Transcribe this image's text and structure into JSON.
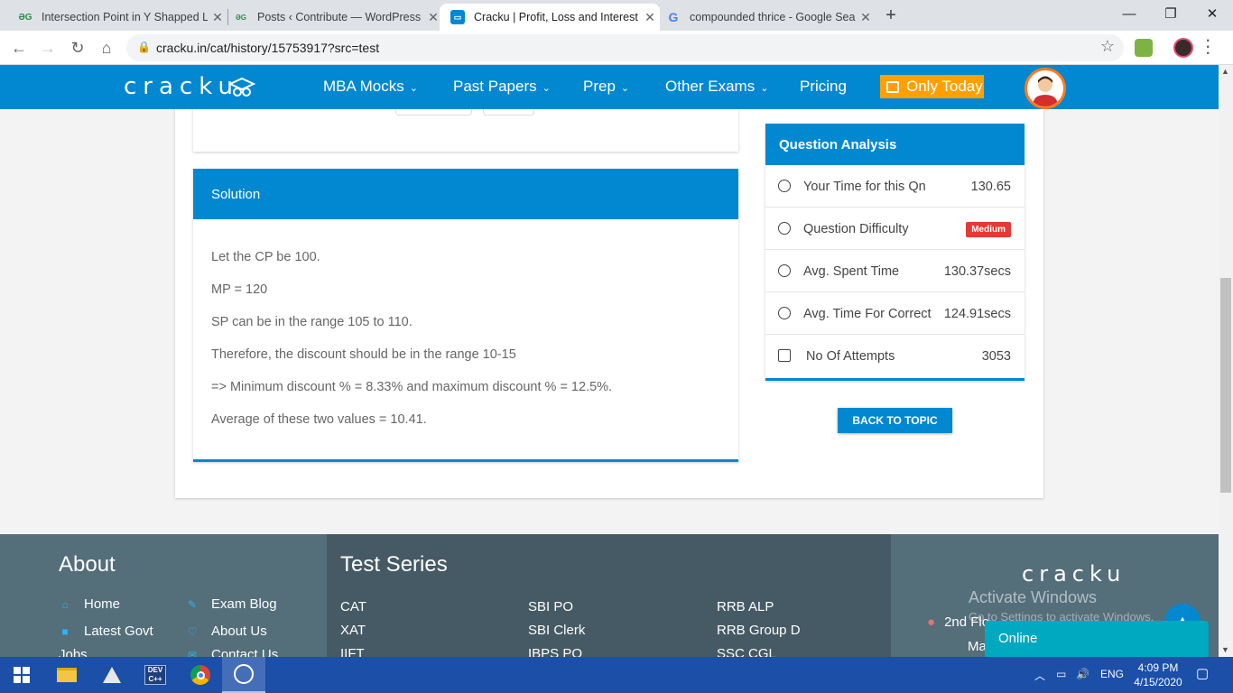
{
  "browser": {
    "tabs": [
      {
        "favicon": "geeksforgeeks-icon",
        "title": "Intersection Point in Y Shapped L",
        "active": false
      },
      {
        "favicon": "geeksforgeeks-icon",
        "title": "Posts ‹ Contribute — WordPress",
        "active": false
      },
      {
        "favicon": "cracku-icon",
        "title": "Cracku | Profit, Loss and Interest",
        "active": true
      },
      {
        "favicon": "google-icon",
        "title": "compounded thrice - Google Sea",
        "active": false
      }
    ],
    "url": "cracku.in/cat/history/15753917?src=test"
  },
  "site": {
    "logo_text": "cracku",
    "nav": [
      {
        "label": "MBA Mocks",
        "has_dropdown": true
      },
      {
        "label": "Past Papers",
        "has_dropdown": true
      },
      {
        "label": "Prep",
        "has_dropdown": true
      },
      {
        "label": "Other Exams",
        "has_dropdown": true
      },
      {
        "label": "Pricing",
        "has_dropdown": false
      }
    ],
    "promo_label": "Only Today",
    "accent_color": "#0288d1",
    "promo_color": "#ffa000"
  },
  "solution": {
    "title": "Solution",
    "lines": [
      "Let the CP be 100.",
      "MP = 120",
      "SP can be in the range 105 to 110.",
      "Therefore, the discount should be in the range 10-15",
      "=> Minimum discount % = 8.33% and maximum discount % = 12.5%.",
      "Average of these two values = 10.41."
    ]
  },
  "analysis": {
    "title": "Question Analysis",
    "rows": [
      {
        "icon": "stopwatch-icon",
        "label": "Your Time for this Qn",
        "value": "130.65"
      },
      {
        "icon": "question-icon",
        "label": "Question Difficulty",
        "badge": "Medium"
      },
      {
        "icon": "clock-icon",
        "label": "Avg. Spent Time",
        "value": "130.37secs"
      },
      {
        "icon": "alarm-icon",
        "label": "Avg. Time For Correct",
        "value": "124.91secs"
      },
      {
        "icon": "edit-icon",
        "label": "No Of Attempts",
        "value": "3053"
      }
    ],
    "back_label": "BACK TO TOPIC"
  },
  "footer": {
    "about_title": "About",
    "about_links": [
      {
        "icon": "home-icon",
        "label": "Home"
      },
      {
        "icon": "pencil-icon",
        "label": "Exam Blog"
      },
      {
        "icon": "briefcase-icon",
        "label": "Latest Govt"
      },
      {
        "icon": "heart-icon",
        "label": "About Us"
      },
      {
        "icon": "",
        "label": "Jobs"
      },
      {
        "icon": "mail-icon",
        "label": "Contact Us"
      }
    ],
    "test_series_title": "Test Series",
    "test_series": [
      [
        "CAT",
        "XAT",
        "IIFT"
      ],
      [
        "SBI PO",
        "SBI Clerk",
        "IBPS PO"
      ],
      [
        "RRB ALP",
        "RRB Group D",
        "SSC CGL"
      ]
    ],
    "logo_text": "cracku",
    "address_line1": "2nd Flo",
    "address_line2": "Ma",
    "online_label": "Online",
    "watermark_line1": "Activate Windows",
    "watermark_line2": "Go to Settings to activate Windows."
  },
  "taskbar": {
    "language": "ENG",
    "time": "4:09 PM",
    "date": "4/15/2020",
    "apps": [
      "windows-start-icon",
      "file-explorer-icon",
      "inkscape-icon",
      "devcpp-icon",
      "chrome-icon",
      "photos-icon"
    ]
  }
}
